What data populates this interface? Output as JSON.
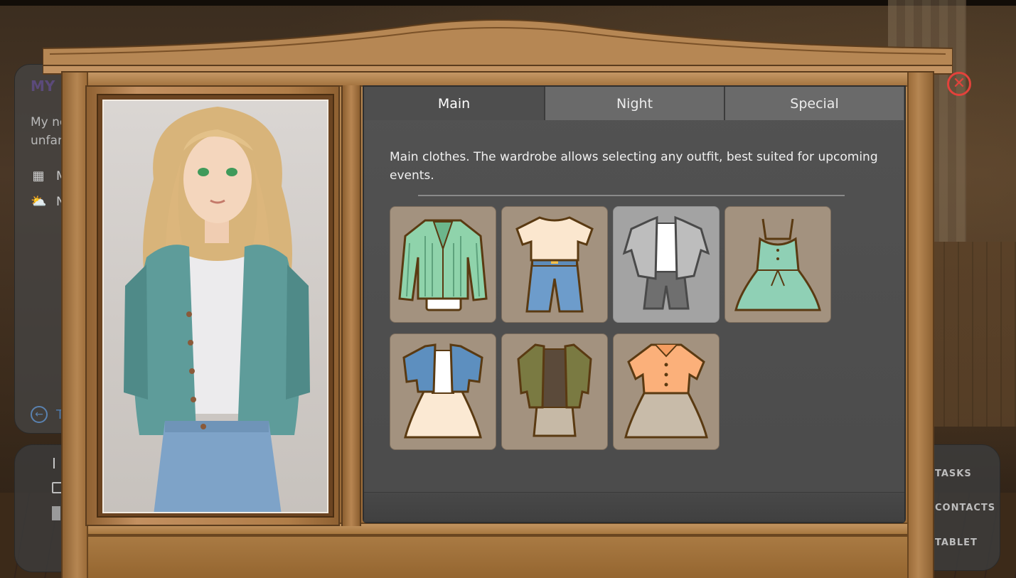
{
  "background_hud": {
    "card_title": "MY L",
    "card_desc_line1": "My ne",
    "card_desc_line2": "unfan",
    "row_date": "M",
    "row_weather": "N",
    "back_label": "T",
    "bottom_left_label": "I",
    "nav_tasks": "TASKS",
    "nav_contacts": "CONTACTS",
    "nav_tablet": "TABLET"
  },
  "wardrobe": {
    "tabs": [
      {
        "label": "Main",
        "active": true
      },
      {
        "label": "Night",
        "active": false
      },
      {
        "label": "Special",
        "active": false
      }
    ],
    "description": "Main clothes. The wardrobe allows selecting any outfit, best suited for upcoming events.",
    "outfits": [
      {
        "icon": "green-striped-blazer-outfit-icon",
        "selected": false
      },
      {
        "icon": "tshirt-jeans-outfit-icon",
        "selected": false
      },
      {
        "icon": "gray-shirt-pants-outfit-icon",
        "selected": true
      },
      {
        "icon": "mint-sundress-outfit-icon",
        "selected": false
      },
      {
        "icon": "denim-jacket-skirt-outfit-icon",
        "selected": false
      },
      {
        "icon": "olive-cardigan-skirt-outfit-icon",
        "selected": false
      },
      {
        "icon": "orange-blouse-skirt-outfit-icon",
        "selected": false
      }
    ],
    "close_icon": "close-icon"
  },
  "colors": {
    "close_red": "#e3423b",
    "tile_bg": "#a3927f",
    "tile_selected_bg": "#a3a3a3",
    "panel_bg": "#525252",
    "wood": "#a4743f"
  }
}
